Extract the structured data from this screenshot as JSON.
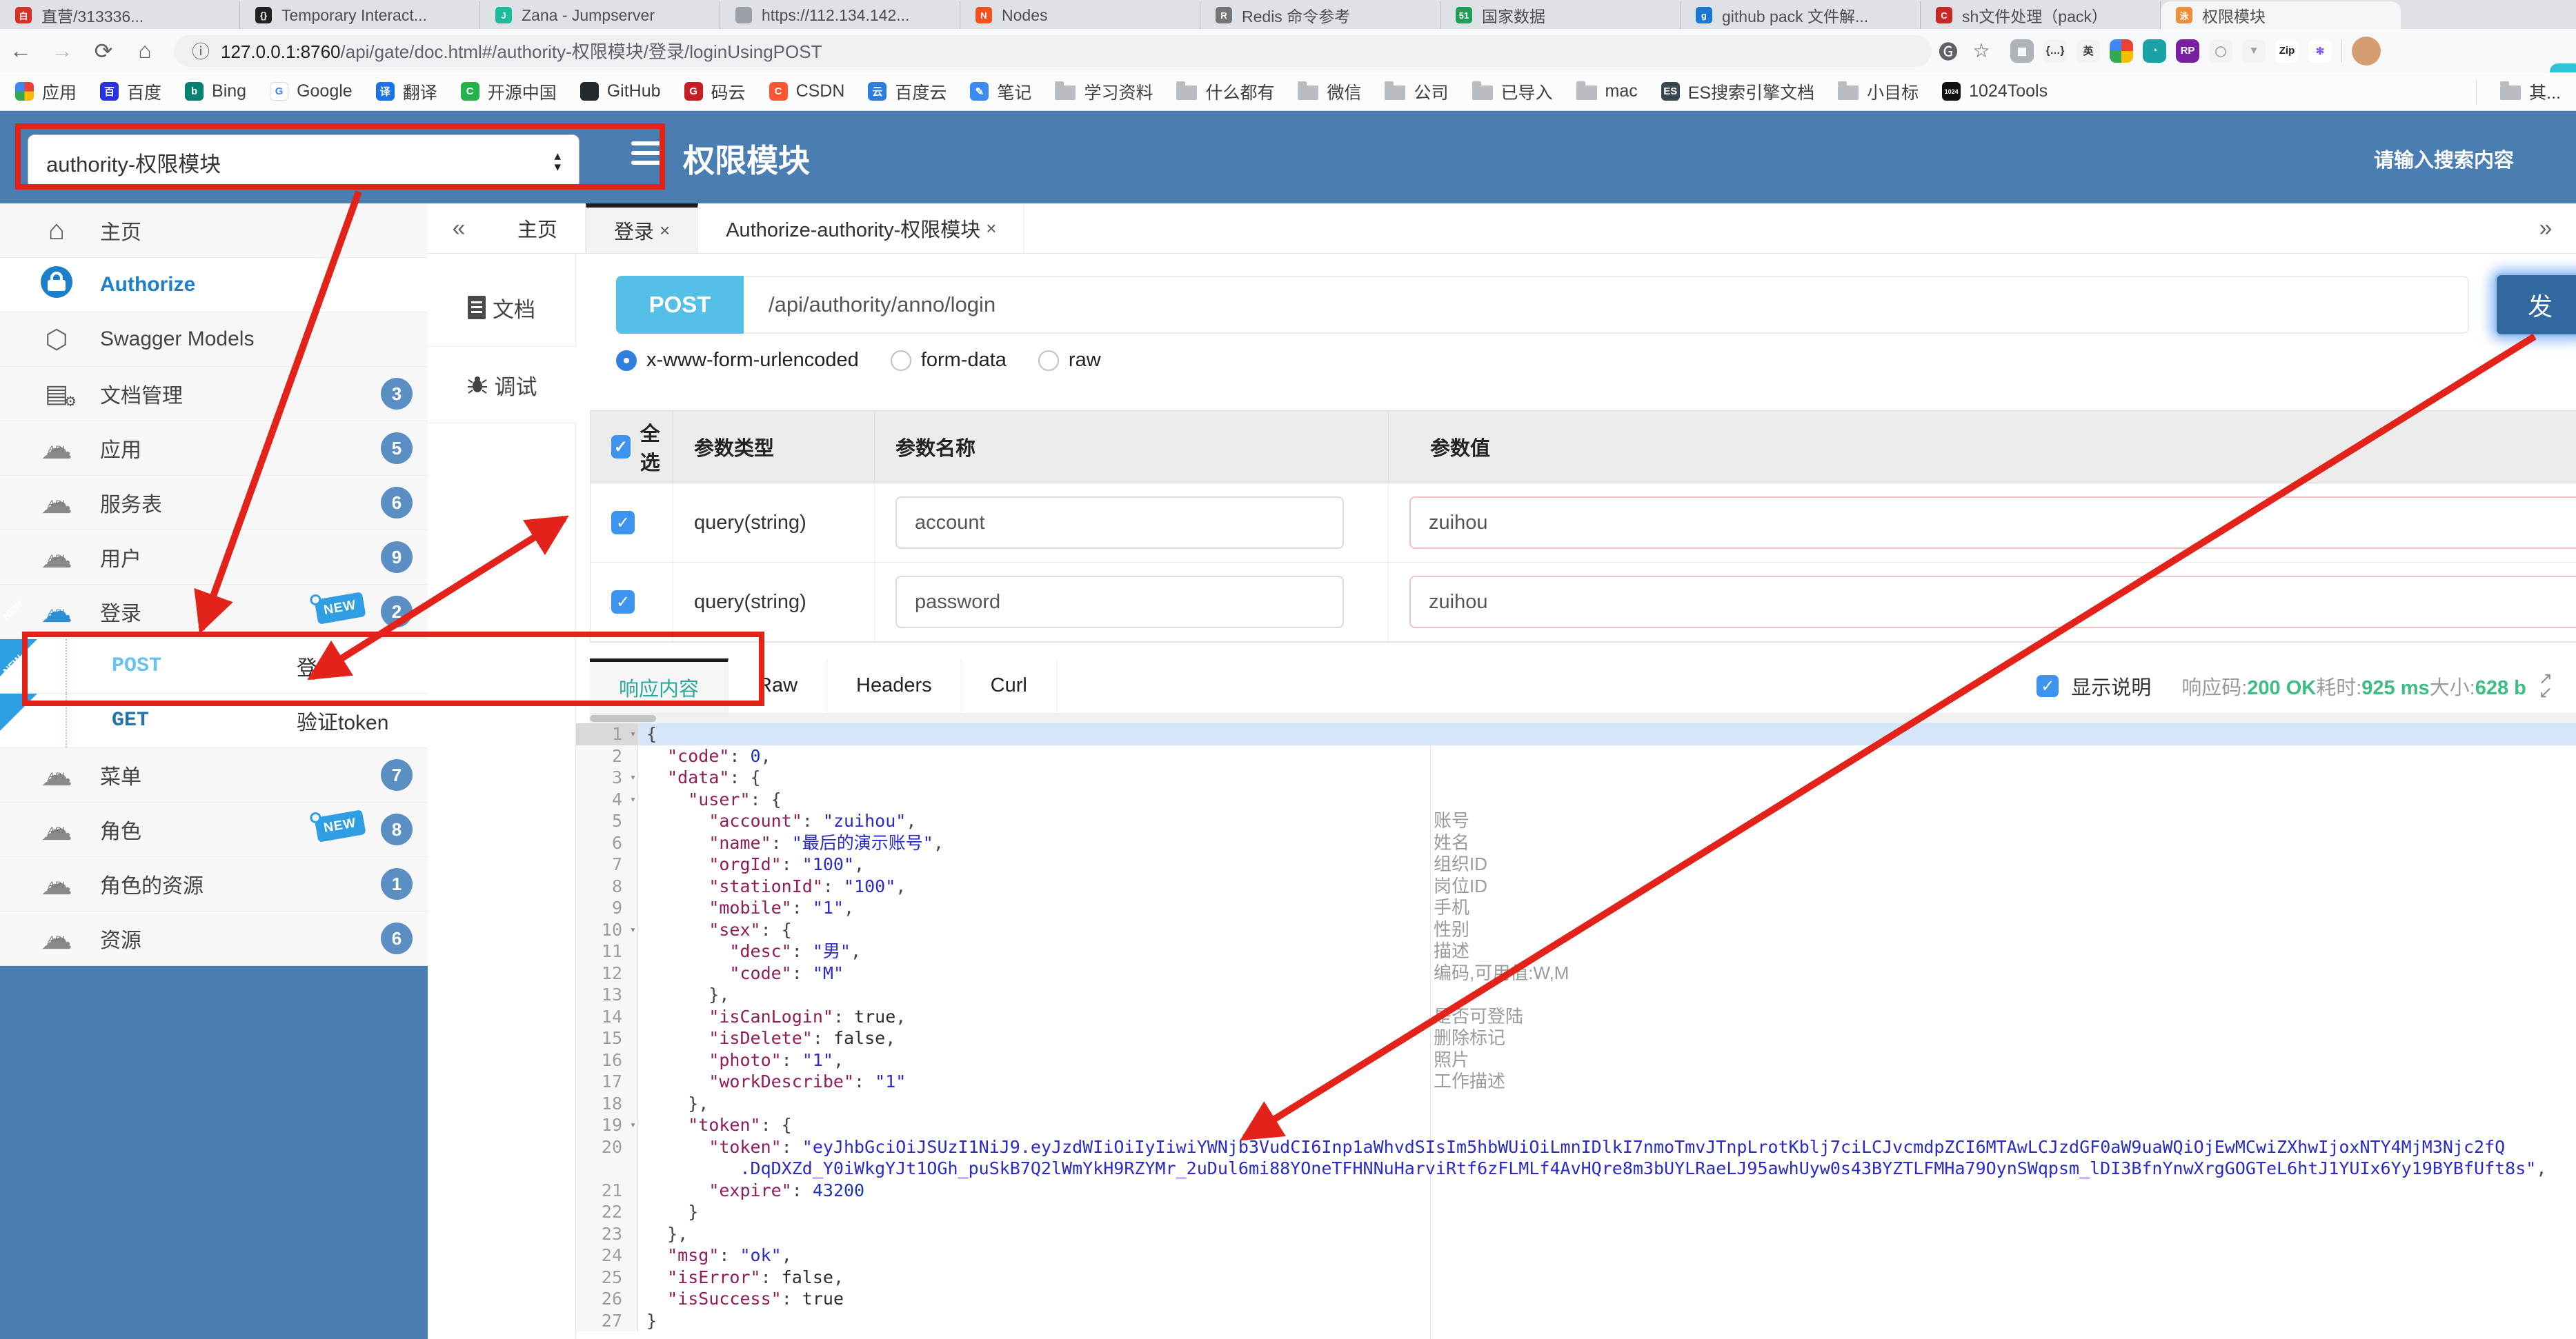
{
  "browser": {
    "tabs": [
      {
        "label": "直营/313336...",
        "color": "#d93025",
        "glyph": "白"
      },
      {
        "label": "Temporary Interact...",
        "color": "#202124",
        "glyph": "{}"
      },
      {
        "label": "Zana - Jumpserver",
        "color": "#1abc9c",
        "glyph": "J"
      },
      {
        "label": "https://112.134.142...",
        "color": "#9aa0a6",
        "glyph": ""
      },
      {
        "label": "Nodes",
        "color": "#f4511e",
        "glyph": "N"
      },
      {
        "label": "Redis 命令参考",
        "color": "#757575",
        "glyph": "R"
      },
      {
        "label": "国家数据",
        "color": "#1e9e57",
        "glyph": "51"
      },
      {
        "label": "github pack 文件解...",
        "color": "#1976d2",
        "glyph": "g"
      },
      {
        "label": "sh文件处理（pack）",
        "color": "#c62828",
        "glyph": "C"
      },
      {
        "label": "权限模块",
        "color": "#ef8e38",
        "glyph": "泳",
        "active": true
      }
    ],
    "toolbar": {
      "url_host": "127.0.0.1:8760",
      "url_path": "/api/gate/doc.html#/authority-权限模块/登录/loginUsingPOST"
    },
    "extensions": [
      {
        "name": "grid-extension",
        "glyph": "▦",
        "bg": "#aeb3b9"
      },
      {
        "name": "braces-extension",
        "glyph": "{…}",
        "bg": "#f1f3f4",
        "fg": "#333"
      },
      {
        "name": "translate-en-extension",
        "glyph": "英",
        "bg": "#f1f3f4",
        "fg": "#333"
      },
      {
        "name": "color-wheel-extension",
        "glyph": "",
        "bg": "conic-gradient(#ea4335 0 90deg,#fbbc04 90deg 180deg,#34a853 180deg 270deg,#4285f4 270deg 360deg)"
      },
      {
        "name": "globe-extension",
        "glyph": "◔",
        "bg": "#1ba2a6"
      },
      {
        "name": "rp-extension",
        "glyph": "RP",
        "bg": "#7b1fa2"
      },
      {
        "name": "ring-extension",
        "glyph": "◯",
        "bg": "#f1f3f4",
        "fg": "#9aa0a6"
      },
      {
        "name": "download-extension",
        "glyph": "▼",
        "bg": "#f1f3f4",
        "fg": "#9aa0a6"
      },
      {
        "name": "gitzip-extension",
        "glyph": "Zip",
        "bg": "#ffffff",
        "fg": "#222"
      },
      {
        "name": "asterisk-extension",
        "glyph": "✻",
        "bg": "#ffffff",
        "fg": "#7c4dff"
      }
    ]
  },
  "bookmarks": {
    "items": [
      {
        "label": "应用",
        "icon": "apps",
        "bg": "conic-gradient(#ea4335 0 90deg,#fbbc04 90deg 180deg,#34a853 180deg 270deg,#4285f4 270deg 360deg)",
        "glyph": ""
      },
      {
        "label": "百度",
        "icon": "baidu",
        "bg": "#2932e1",
        "glyph": "百"
      },
      {
        "label": "Bing",
        "icon": "bing",
        "bg": "#008373",
        "glyph": "b"
      },
      {
        "label": "Google",
        "icon": "google",
        "bg": "#ffffff",
        "fg": "#4285f4",
        "glyph": "G",
        "border": true
      },
      {
        "label": "翻译",
        "icon": "translate",
        "bg": "#1a73e8",
        "glyph": "译"
      },
      {
        "label": "开源中国",
        "icon": "oschina",
        "bg": "#24b34b",
        "glyph": "C"
      },
      {
        "label": "GitHub",
        "icon": "github",
        "bg": "#24292e",
        "glyph": ""
      },
      {
        "label": "码云",
        "icon": "gitee",
        "bg": "#c71d23",
        "glyph": "G"
      },
      {
        "label": "CSDN",
        "icon": "csdn",
        "bg": "#fc5531",
        "glyph": "C"
      },
      {
        "label": "百度云",
        "icon": "baiduyun",
        "bg": "#2b7de1",
        "glyph": "云"
      },
      {
        "label": "笔记",
        "icon": "note",
        "bg": "#3d8af2",
        "glyph": "✎"
      },
      {
        "label": "学习资料",
        "icon": "folder"
      },
      {
        "label": "什么都有",
        "icon": "folder"
      },
      {
        "label": "微信",
        "icon": "folder"
      },
      {
        "label": "公司",
        "icon": "folder"
      },
      {
        "label": "已导入",
        "icon": "folder"
      },
      {
        "label": "mac",
        "icon": "folder"
      },
      {
        "label": "ES搜索引擎文档",
        "icon": "book",
        "bg": "#37474f",
        "glyph": "ES"
      },
      {
        "label": "小目标",
        "icon": "folder"
      },
      {
        "label": "1024Tools",
        "icon": "tools1024",
        "bg": "#111111",
        "glyph": "1024"
      }
    ],
    "overflow_label": "其..."
  },
  "header": {
    "module_select": "authority-权限模块",
    "title": "权限模块",
    "search_hint": "请输入搜索内容"
  },
  "sidebar": {
    "new_label": "NEW",
    "items": [
      {
        "kind": "main",
        "label": "主页",
        "icon": "home"
      },
      {
        "kind": "main",
        "label": "Authorize",
        "icon": "lock",
        "white": true,
        "authorize": true
      },
      {
        "kind": "main",
        "label": "Swagger Models",
        "icon": "hexagon"
      },
      {
        "kind": "main",
        "label": "文档管理",
        "icon": "docgear",
        "badge": "3"
      },
      {
        "kind": "main",
        "label": "应用",
        "icon": "cloud",
        "badge": "5"
      },
      {
        "kind": "main",
        "label": "服务表",
        "icon": "cloud",
        "badge": "6"
      },
      {
        "kind": "main",
        "label": "用户",
        "icon": "cloud",
        "badge": "9"
      },
      {
        "kind": "main",
        "label": "登录",
        "icon": "cloudblue",
        "badge": "2",
        "isNew": true
      },
      {
        "kind": "sub",
        "method": "POST",
        "label": "登录",
        "corner": true
      },
      {
        "kind": "sub",
        "method": "GET",
        "label": "验证token",
        "corner": true
      },
      {
        "kind": "main",
        "label": "菜单",
        "icon": "cloud",
        "badge": "7"
      },
      {
        "kind": "main",
        "label": "角色",
        "icon": "cloud",
        "badge": "8",
        "isNew": true
      },
      {
        "kind": "main",
        "label": "角色的资源",
        "icon": "cloud",
        "badge": "1"
      },
      {
        "kind": "main",
        "label": "资源",
        "icon": "cloud",
        "badge": "6"
      }
    ]
  },
  "doc_tabs": {
    "collapse": "«",
    "expand": "»",
    "tabs": [
      {
        "label": "主页"
      },
      {
        "label": "登录",
        "close": "×",
        "active": true
      },
      {
        "label": "Authorize-authority-权限模块",
        "close": "×"
      }
    ]
  },
  "side_rail": {
    "doc_label": "文档",
    "debug_label": "调试"
  },
  "request": {
    "method": "POST",
    "path": "/api/authority/anno/login",
    "send_label": "发",
    "body_types": [
      {
        "label": "x-www-form-urlencoded",
        "selected": true
      },
      {
        "label": "form-data",
        "selected": false
      },
      {
        "label": "raw",
        "selected": false
      }
    ],
    "table": {
      "headers": [
        "全选",
        "参数类型",
        "参数名称",
        "参数值"
      ],
      "rows": [
        {
          "checked": true,
          "type": "query(string)",
          "name": "account",
          "value": "zuihou"
        },
        {
          "checked": true,
          "type": "query(string)",
          "name": "password",
          "value": "zuihou"
        }
      ]
    }
  },
  "response": {
    "tabs": [
      {
        "label": "响应内容",
        "active": true
      },
      {
        "label": "Raw"
      },
      {
        "label": "Headers"
      },
      {
        "label": "Curl"
      }
    ],
    "show_desc": "显示说明",
    "code_label": "响应码:",
    "code": "200 OK",
    "time_label": "耗时:",
    "time": "925 ms",
    "size_label": "大小:",
    "size": "628 b"
  },
  "editor": {
    "lines": [
      {
        "n": 1,
        "fold": true,
        "active": true,
        "t": [
          [
            "pl",
            "{"
          ]
        ]
      },
      {
        "n": 2,
        "t": [
          [
            "pl",
            "  "
          ],
          [
            "ky",
            "\"code\""
          ],
          [
            "pl",
            ": "
          ],
          [
            "nu",
            "0"
          ],
          [
            "pl",
            ","
          ]
        ]
      },
      {
        "n": 3,
        "fold": true,
        "t": [
          [
            "pl",
            "  "
          ],
          [
            "ky",
            "\"data\""
          ],
          [
            "pl",
            ": {"
          ]
        ]
      },
      {
        "n": 4,
        "fold": true,
        "t": [
          [
            "pl",
            "    "
          ],
          [
            "ky",
            "\"user\""
          ],
          [
            "pl",
            ": {"
          ]
        ]
      },
      {
        "n": 5,
        "note": "账号",
        "t": [
          [
            "pl",
            "      "
          ],
          [
            "ky",
            "\"account\""
          ],
          [
            "pl",
            ": "
          ],
          [
            "st",
            "\"zuihou\""
          ],
          [
            "pl",
            ","
          ]
        ]
      },
      {
        "n": 6,
        "note": "姓名",
        "t": [
          [
            "pl",
            "      "
          ],
          [
            "ky",
            "\"name\""
          ],
          [
            "pl",
            ": "
          ],
          [
            "st",
            "\"最后的演示账号\""
          ],
          [
            "pl",
            ","
          ]
        ]
      },
      {
        "n": 7,
        "note": "组织ID",
        "t": [
          [
            "pl",
            "      "
          ],
          [
            "ky",
            "\"orgId\""
          ],
          [
            "pl",
            ": "
          ],
          [
            "st",
            "\"100\""
          ],
          [
            "pl",
            ","
          ]
        ]
      },
      {
        "n": 8,
        "note": "岗位ID",
        "t": [
          [
            "pl",
            "      "
          ],
          [
            "ky",
            "\"stationId\""
          ],
          [
            "pl",
            ": "
          ],
          [
            "st",
            "\"100\""
          ],
          [
            "pl",
            ","
          ]
        ]
      },
      {
        "n": 9,
        "note": "手机",
        "t": [
          [
            "pl",
            "      "
          ],
          [
            "ky",
            "\"mobile\""
          ],
          [
            "pl",
            ": "
          ],
          [
            "st",
            "\"1\""
          ],
          [
            "pl",
            ","
          ]
        ]
      },
      {
        "n": 10,
        "fold": true,
        "note": "性别",
        "t": [
          [
            "pl",
            "      "
          ],
          [
            "ky",
            "\"sex\""
          ],
          [
            "pl",
            ": {"
          ]
        ]
      },
      {
        "n": 11,
        "note": "描述",
        "t": [
          [
            "pl",
            "        "
          ],
          [
            "ky",
            "\"desc\""
          ],
          [
            "pl",
            ": "
          ],
          [
            "st",
            "\"男\""
          ],
          [
            "pl",
            ","
          ]
        ]
      },
      {
        "n": 12,
        "note": "编码,可用值:W,M",
        "t": [
          [
            "pl",
            "        "
          ],
          [
            "ky",
            "\"code\""
          ],
          [
            "pl",
            ": "
          ],
          [
            "st",
            "\"M\""
          ]
        ]
      },
      {
        "n": 13,
        "t": [
          [
            "pl",
            "      },"
          ]
        ]
      },
      {
        "n": 14,
        "note": "是否可登陆",
        "t": [
          [
            "pl",
            "      "
          ],
          [
            "ky",
            "\"isCanLogin\""
          ],
          [
            "pl",
            ": "
          ],
          [
            "bo",
            "true"
          ],
          [
            "pl",
            ","
          ]
        ]
      },
      {
        "n": 15,
        "note": "删除标记",
        "t": [
          [
            "pl",
            "      "
          ],
          [
            "ky",
            "\"isDelete\""
          ],
          [
            "pl",
            ": "
          ],
          [
            "bo",
            "false"
          ],
          [
            "pl",
            ","
          ]
        ]
      },
      {
        "n": 16,
        "note": "照片",
        "t": [
          [
            "pl",
            "      "
          ],
          [
            "ky",
            "\"photo\""
          ],
          [
            "pl",
            ": "
          ],
          [
            "st",
            "\"1\""
          ],
          [
            "pl",
            ","
          ]
        ]
      },
      {
        "n": 17,
        "note": "工作描述",
        "t": [
          [
            "pl",
            "      "
          ],
          [
            "ky",
            "\"workDescribe\""
          ],
          [
            "pl",
            ": "
          ],
          [
            "st",
            "\"1\""
          ]
        ]
      },
      {
        "n": 18,
        "t": [
          [
            "pl",
            "    },"
          ]
        ]
      },
      {
        "n": 19,
        "fold": true,
        "t": [
          [
            "pl",
            "    "
          ],
          [
            "ky",
            "\"token\""
          ],
          [
            "pl",
            ": {"
          ]
        ]
      },
      {
        "n": 20,
        "t": [
          [
            "pl",
            "      "
          ],
          [
            "ky",
            "\"token\""
          ],
          [
            "pl",
            ": "
          ],
          [
            "st",
            "\"eyJhbGciOiJSUzI1NiJ9.eyJzdWIiOiIyIiwiYWNjb3VudCI6Inp1aWhvdSIsIm5hbWUiOiLmnIDlkI7nmoTmvJTnpLrotKblj7ciLCJvcmdpZCI6MTAwLCJzdGF0aW9uaWQiOjEwMCwiZXhwIjoxNTY4MjM3Njc2fQ"
          ]
        ],
        "wrap": [
          [
            "st",
            "         .DqDXZd_Y0iWkgYJt1OGh_puSkB7Q2lWmYkH9RZYMr_2uDul6mi88YOneTFHNNuHarviRtf6zFLMLf4AvHQre8m3bUYLRaeLJ95awhUyw0s43BYZTLFMHa79OynSWqpsm_lDI3BfnYnwXrgGOGTeL6htJ1YUIx6Yy19BYBfUft8s\""
          ],
          [
            "pl",
            ","
          ]
        ]
      },
      {
        "n": 21,
        "t": [
          [
            "pl",
            "      "
          ],
          [
            "ky",
            "\"expire\""
          ],
          [
            "pl",
            ": "
          ],
          [
            "nu",
            "43200"
          ]
        ]
      },
      {
        "n": 22,
        "t": [
          [
            "pl",
            "    }"
          ]
        ]
      },
      {
        "n": 23,
        "t": [
          [
            "pl",
            "  },"
          ]
        ]
      },
      {
        "n": 24,
        "t": [
          [
            "pl",
            "  "
          ],
          [
            "ky",
            "\"msg\""
          ],
          [
            "pl",
            ": "
          ],
          [
            "st",
            "\"ok\""
          ],
          [
            "pl",
            ","
          ]
        ]
      },
      {
        "n": 25,
        "t": [
          [
            "pl",
            "  "
          ],
          [
            "ky",
            "\"isError\""
          ],
          [
            "pl",
            ": "
          ],
          [
            "bo",
            "false"
          ],
          [
            "pl",
            ","
          ]
        ]
      },
      {
        "n": 26,
        "t": [
          [
            "pl",
            "  "
          ],
          [
            "ky",
            "\"isSuccess\""
          ],
          [
            "pl",
            ": "
          ],
          [
            "bo",
            "true"
          ]
        ]
      },
      {
        "n": 27,
        "t": [
          [
            "pl",
            "}"
          ]
        ]
      }
    ]
  },
  "annotation_color": "#e3231a"
}
